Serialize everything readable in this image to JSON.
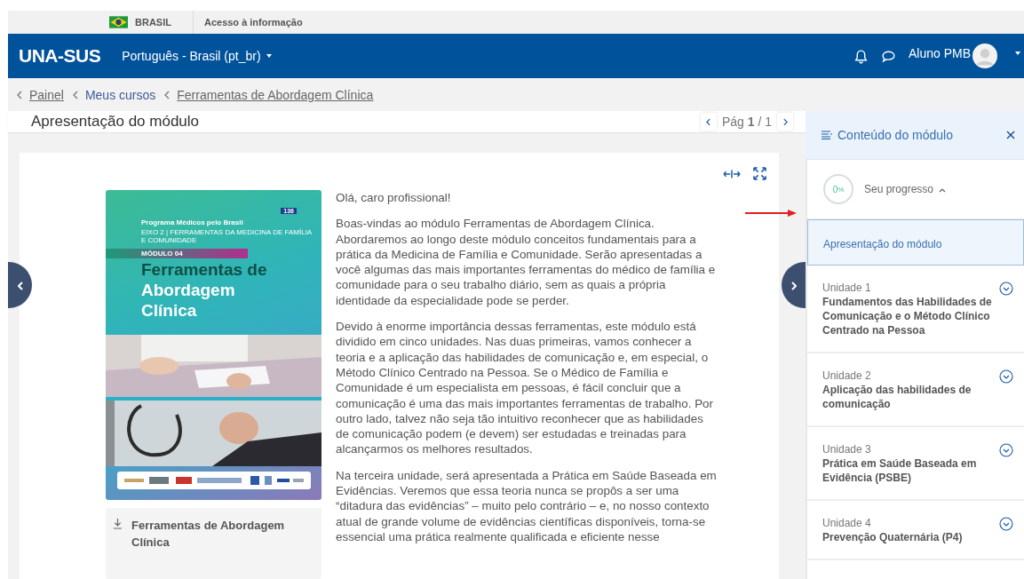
{
  "gov_bar": {
    "country": "BRASIL",
    "link": "Acesso à informação"
  },
  "navbar": {
    "logo": "UNA-SUS",
    "language": "Português - Brasil (pt_br)",
    "user": "Aluno PMB"
  },
  "breadcrumb": [
    {
      "label": "Painel",
      "underlined": true
    },
    {
      "label": "Meus cursos",
      "underlined": false
    },
    {
      "label": "Ferramentas de Abordagem Clínica",
      "underlined": true
    }
  ],
  "page": {
    "title": "Apresentação do módulo",
    "pager": "Pág **1** / 1"
  },
  "cover": {
    "program": "Programa Médicos pelo Brasil",
    "axis": "EIXO 2 | FERRAMENTAS DA MEDICINA DE FAMÍLIA E COMUNIDADE",
    "badge": "136",
    "module": "MÓDULO 04",
    "title_top": "Ferramentas de",
    "title_bottom": "Abordagem Clínica"
  },
  "download": {
    "label": "Ferramentas de Abordagem Clínica"
  },
  "paragraphs": [
    "Olá, caro profissional!",
    "Boas-vindas ao módulo Ferramentas de Abordagem Clínica. Abordaremos ao longo deste módulo conceitos fundamentais para a prática da Medicina de Família e Comunidade. Serão apresentadas a você algumas das mais importantes ferramentas do médico de família e comunidade para o seu trabalho diário, sem as quais a própria identidade da especialidade pode se perder.",
    "Devido à enorme importância dessas ferramentas, este módulo está dividido em cinco unidades. Nas duas primeiras, vamos conhecer a teoria e a aplicação das habilidades de comunicação e, em especial, o Método Clínico Centrado na Pessoa. Se o Médico de Família e Comunidade é um especialista em pessoas, é fácil concluir que a comunicação é uma das mais importantes ferramentas de trabalho. Por outro lado, talvez não seja tão intuitivo reconhecer que as habilidades de comunicação podem (e devem) ser estudadas e treinadas para alcançarmos os melhores resultados.",
    "Na terceira unidade, será apresentada a Prática em Saúde Baseada em Evidências. Veremos que essa teoria nunca se propôs a ser uma “ditadura das evidências” – muito pelo contrário – e, no nosso contexto atual de grande volume de evidências científicas disponíveis, torna-se essencial uma prática realmente qualificada e eficiente nesse"
  ],
  "sidebar": {
    "title": "Conteúdo do módulo",
    "progress": {
      "value": "0",
      "unit": "%",
      "label": "Seu progresso"
    },
    "items": [
      {
        "title": "Apresentação do módulo",
        "selected": true
      },
      {
        "unit": "Unidade 1",
        "title": "Fundamentos das Habilidades de Comunicação e o Método Clínico Centrado na Pessoa",
        "selected": false
      },
      {
        "unit": "Unidade 2",
        "title": "Aplicação das habilidades de comunicação",
        "selected": false
      },
      {
        "unit": "Unidade 3",
        "title": "Prática em Saúde Baseada em Evidência (PSBE)",
        "selected": false
      },
      {
        "unit": "Unidade 4",
        "title": "Prevenção Quaternária (P4)",
        "selected": false
      }
    ]
  }
}
